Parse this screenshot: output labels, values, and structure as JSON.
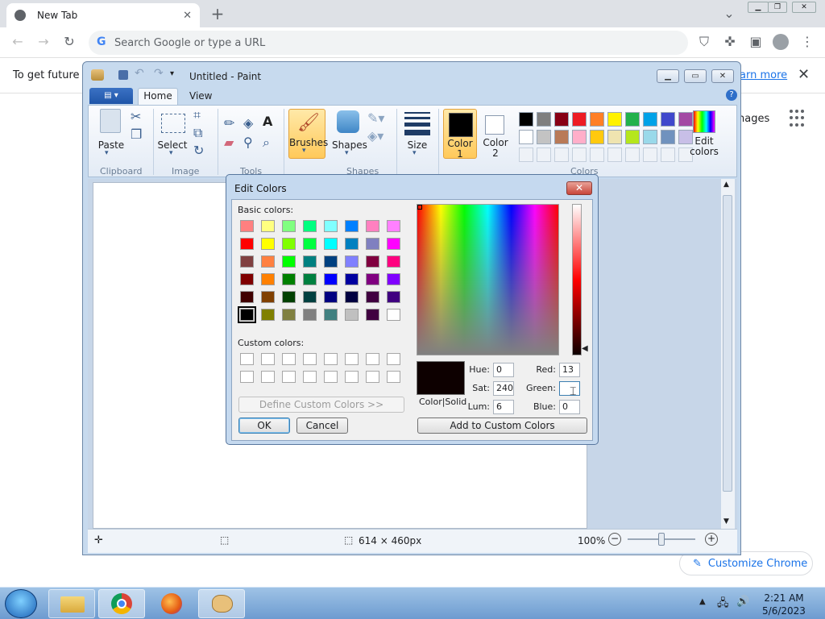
{
  "chrome": {
    "tab_title": "New Tab",
    "omnibox_placeholder": "Search Google or type a URL",
    "infobar_text": "To get future G",
    "infobar_link": "earn more",
    "ntp_images": "nages",
    "customize_label": "Customize Chrome"
  },
  "paint": {
    "title": "Untitled - Paint",
    "tabs": [
      "Home",
      "View"
    ],
    "groups": {
      "clipboard": "Clipboard",
      "image": "Image",
      "tools": "Tools",
      "shapes": "Shapes",
      "colors": "Colors"
    },
    "buttons": {
      "paste": "Paste",
      "select": "Select",
      "brushes": "Brushes",
      "shapes": "Shapes",
      "size": "Size",
      "color1": "Color\n1",
      "color2": "Color\n2",
      "edit_colors": "Edit\ncolors"
    },
    "palette_row1": [
      "#000000",
      "#7f7f7f",
      "#880015",
      "#ed1c24",
      "#ff7f27",
      "#fff200",
      "#22b14c",
      "#00a2e8",
      "#3f48cc",
      "#a349a4"
    ],
    "palette_row2": [
      "#ffffff",
      "#c3c3c3",
      "#b97a57",
      "#ffaec9",
      "#ffc90e",
      "#efe4b0",
      "#b5e61d",
      "#99d9ea",
      "#7092be",
      "#c8bfe7"
    ],
    "status": {
      "canvas_size": "614 × 460px",
      "zoom": "100%"
    }
  },
  "dialog": {
    "title": "Edit Colors",
    "basic_colors_label": "Basic colors:",
    "custom_colors_label": "Custom colors:",
    "basic_colors": [
      "#ff8080",
      "#ffff80",
      "#80ff80",
      "#00ff80",
      "#80ffff",
      "#0080ff",
      "#ff80c0",
      "#ff80ff",
      "#ff0000",
      "#ffff00",
      "#80ff00",
      "#00ff40",
      "#00ffff",
      "#0080c0",
      "#8080c0",
      "#ff00ff",
      "#804040",
      "#ff8040",
      "#00ff00",
      "#008080",
      "#004080",
      "#8080ff",
      "#800040",
      "#ff0080",
      "#800000",
      "#ff8000",
      "#008000",
      "#008040",
      "#0000ff",
      "#0000a0",
      "#800080",
      "#8000ff",
      "#400000",
      "#804000",
      "#004000",
      "#004040",
      "#000080",
      "#000040",
      "#400040",
      "#400080",
      "#000000",
      "#808000",
      "#808040",
      "#808080",
      "#408080",
      "#c0c0c0",
      "#400040",
      "#ffffff"
    ],
    "define_custom_label": "Define Custom Colors >>",
    "ok_label": "OK",
    "cancel_label": "Cancel",
    "color_solid_label": "Color|Solid",
    "add_custom_label": "Add to Custom Colors",
    "preview_color": "#0d0000",
    "fields": {
      "hue_label": "Hue:",
      "hue": "0",
      "sat_label": "Sat:",
      "sat": "240",
      "lum_label": "Lum:",
      "lum": "6",
      "red_label": "Red:",
      "red": "13",
      "green_label": "Green:",
      "green": "",
      "blue_label": "Blue:",
      "blue": "0"
    }
  },
  "taskbar": {
    "time": "2:21 AM",
    "date": "5/6/2023"
  }
}
